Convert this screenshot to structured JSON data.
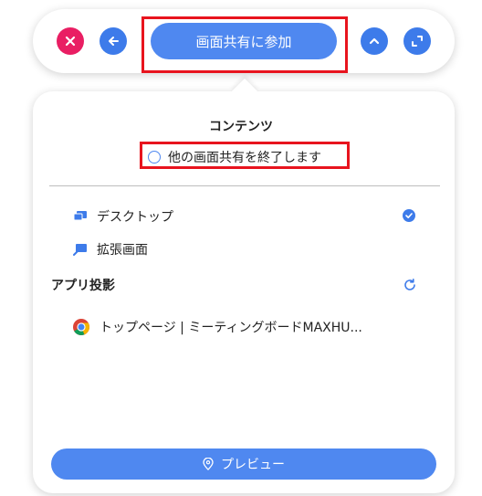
{
  "toolbar": {
    "join_label": "画面共有に参加",
    "icons": [
      "close-icon",
      "back-arrow-icon",
      "chevron-up-icon",
      "expand-icon"
    ]
  },
  "panel": {
    "title": "コンテンツ",
    "end_share_label": "他の画面共有を終了します",
    "items": {
      "desktop": "デスクトップ",
      "extended": "拡張画面"
    },
    "app_section_title": "アプリ投影",
    "app_page_label": "トップページ | ミーティングボードMAXHU...",
    "preview_label": "プレビュー"
  },
  "colors": {
    "accent": "#4f88f0",
    "close": "#e91e63",
    "highlight": "#e8141e"
  }
}
